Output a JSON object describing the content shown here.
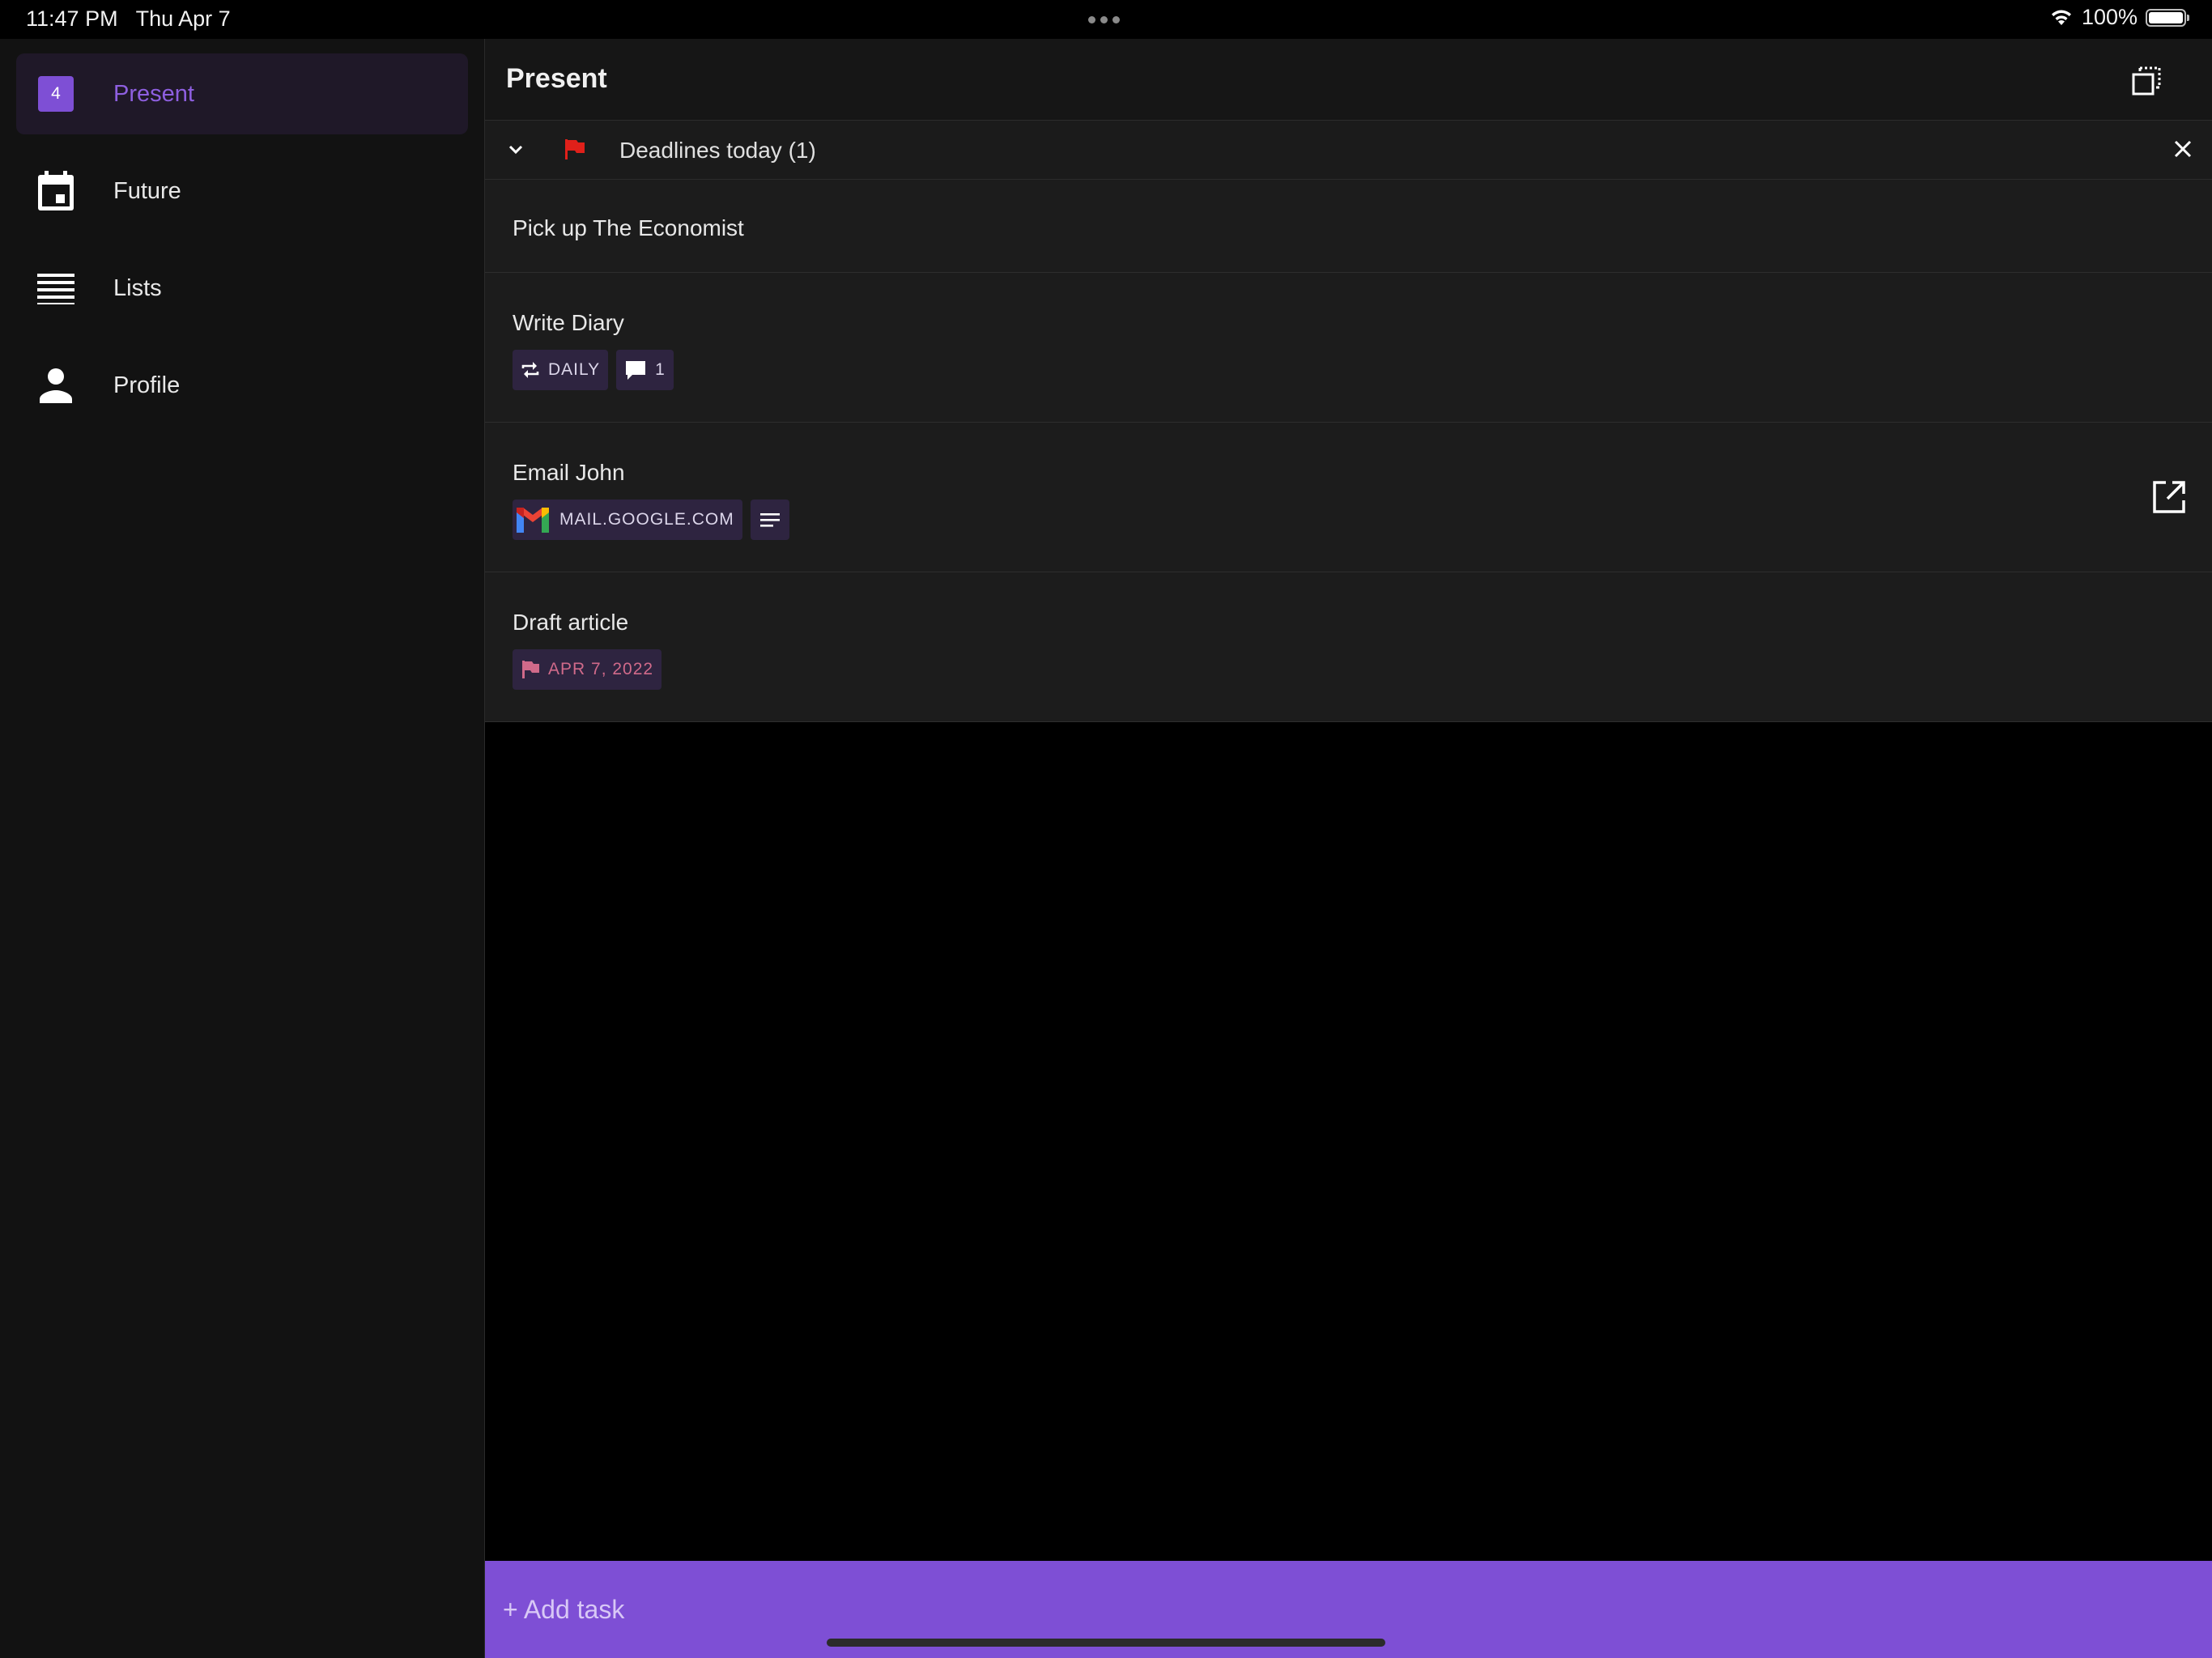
{
  "status_bar": {
    "time": "11:47 PM",
    "date": "Thu Apr 7",
    "battery": "100%",
    "icons": [
      "wifi-icon",
      "battery-icon",
      "multitask-dots-icon"
    ]
  },
  "sidebar": {
    "items": [
      {
        "label": "Present",
        "badge": "4",
        "icon": "count-badge",
        "active": true
      },
      {
        "label": "Future",
        "icon": "calendar-icon"
      },
      {
        "label": "Lists",
        "icon": "list-lines-icon"
      },
      {
        "label": "Profile",
        "icon": "person-icon"
      }
    ]
  },
  "header": {
    "title": "Present",
    "action_icon": "select-multiple-icon"
  },
  "deadlines": {
    "label": "Deadlines today (1)",
    "icons": [
      "chevron-down-icon",
      "flag-icon",
      "close-icon"
    ]
  },
  "tasks": [
    {
      "title": "Pick up The Economist"
    },
    {
      "title": "Write Diary",
      "chips": {
        "repeat": "DAILY",
        "comments": "1"
      }
    },
    {
      "title": "Email John",
      "chips": {
        "link": "MAIL.GOOGLE.COM"
      }
    },
    {
      "title": "Draft article",
      "chips": {
        "deadline": "APR 7, 2022"
      }
    }
  ],
  "add_task": {
    "label": "+ Add task"
  },
  "colors": {
    "accent": "#7e4fd5",
    "accent_text": "#8e5fe0",
    "chip_bg": "#2e2440",
    "deadline_text": "#d06a8a",
    "flag_red": "#e0201a"
  }
}
